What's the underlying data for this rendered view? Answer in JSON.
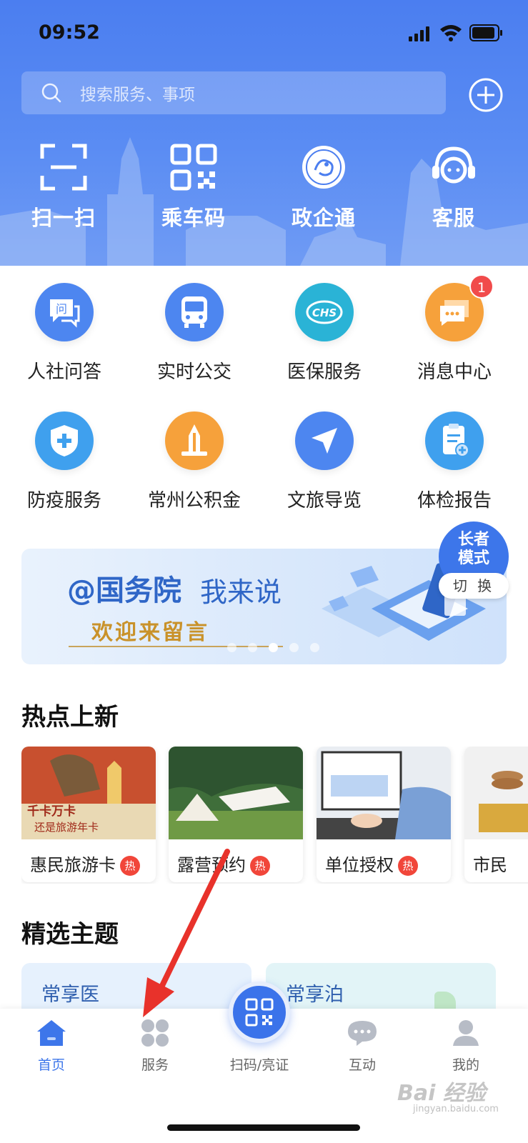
{
  "status_bar": {
    "time": "09:52"
  },
  "search": {
    "placeholder": "搜索服务、事项"
  },
  "quick_actions": [
    {
      "label": "扫一扫",
      "icon": "scan-icon"
    },
    {
      "label": "乘车码",
      "icon": "qr-code-icon"
    },
    {
      "label": "政企通",
      "icon": "emblem-icon"
    },
    {
      "label": "客服",
      "icon": "headset-icon"
    }
  ],
  "services": [
    {
      "label": "人社问答",
      "icon": "chat-question-icon",
      "color": "#4d86f0"
    },
    {
      "label": "实时公交",
      "icon": "bus-icon",
      "color": "#4d86f0"
    },
    {
      "label": "医保服务",
      "icon": "chs-icon",
      "color": "#2ab3d6"
    },
    {
      "label": "消息中心",
      "icon": "message-icon",
      "color": "#f6a13b",
      "badge": "1"
    },
    {
      "label": "防疫服务",
      "icon": "shield-plus-icon",
      "color": "#3fa0ee"
    },
    {
      "label": "常州公积金",
      "icon": "tower-icon",
      "color": "#f6a13b"
    },
    {
      "label": "文旅导览",
      "icon": "navigation-icon",
      "color": "#4d86f0"
    },
    {
      "label": "体检报告",
      "icon": "report-icon",
      "color": "#3fa0ee"
    }
  ],
  "banner": {
    "title": "@国务院",
    "title2": "我来说",
    "subtitle": "欢迎来留言",
    "active_dot": 2
  },
  "elder_mode": {
    "line1": "长者",
    "line2": "模式",
    "switch": "切 换"
  },
  "hot": {
    "title": "热点上新",
    "hot_tag": "热",
    "items": [
      {
        "label": "惠民旅游卡",
        "hot": true,
        "img_text1": "千卡万卡",
        "img_text2": "还是旅游年卡"
      },
      {
        "label": "露营预约",
        "hot": true
      },
      {
        "label": "单位授权",
        "hot": true
      },
      {
        "label": "市民",
        "hot": false
      }
    ]
  },
  "themes": {
    "title": "精选主题",
    "items": [
      {
        "label": "常享医",
        "color": "#e6f1fd"
      },
      {
        "label": "常享泊",
        "color": "#e2f4f7"
      }
    ]
  },
  "nav": [
    {
      "label": "首页",
      "icon": "home-icon",
      "active": true
    },
    {
      "label": "服务",
      "icon": "grid-icon",
      "active": false
    },
    {
      "label": "扫码/亮证",
      "icon": "qr-scan-icon",
      "active": false
    },
    {
      "label": "互动",
      "icon": "chat-bubble-icon",
      "active": false
    },
    {
      "label": "我的",
      "icon": "user-icon",
      "active": false
    }
  ],
  "watermark": {
    "text": "Bai 经验",
    "sub": "jingyan.baidu.com"
  },
  "colors": {
    "primary": "#3d76ea",
    "hot": "#f1463a",
    "annotation_arrow": "#e8322b"
  }
}
